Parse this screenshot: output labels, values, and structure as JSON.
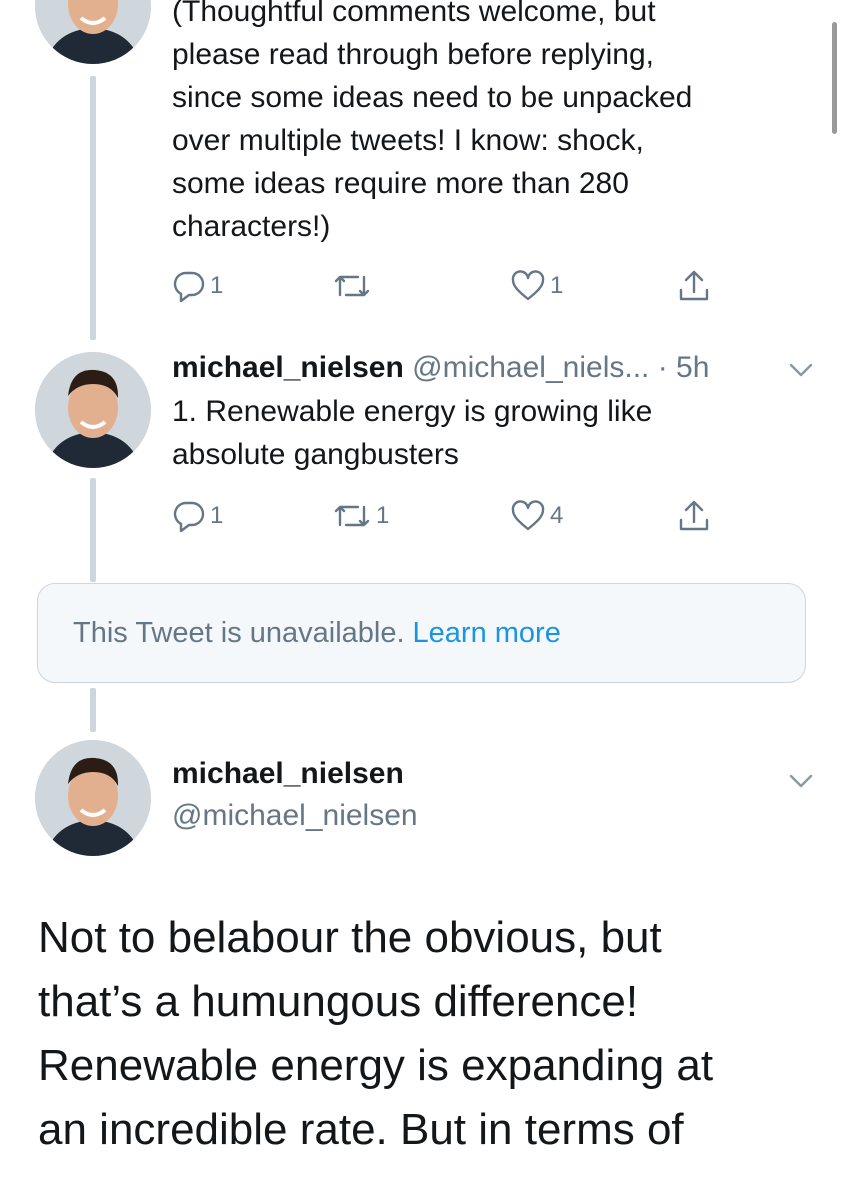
{
  "tweet1": {
    "text_lines": [
      "(Thoughtful comments welcome, but",
      "please read through before replying,",
      "since some ideas need to be unpacked",
      "over multiple tweets! I know: shock,",
      "some ideas require more than 280",
      "characters!)"
    ],
    "reply_count": "1",
    "retweet_count": "",
    "like_count": "1"
  },
  "tweet2": {
    "name": "michael_nielsen",
    "handle": "@michael_niels...",
    "time": "· 5h",
    "text_lines": [
      "1. Renewable energy is growing like",
      "absolute gangbusters"
    ],
    "reply_count": "1",
    "retweet_count": "1",
    "like_count": "4"
  },
  "unavailable": {
    "text": "This Tweet is unavailable.",
    "link": "Learn more"
  },
  "main_tweet": {
    "name": "michael_nielsen",
    "handle": "@michael_nielsen",
    "text_lines": [
      "Not to belabour the obvious, but",
      "that’s a humungous difference!",
      "Renewable energy is expanding at",
      "an incredible rate. But in terms of"
    ]
  },
  "colors": {
    "text": "#14171a",
    "secondary": "#657786",
    "link": "#1b95e0",
    "thread_line": "#ccd6dd",
    "card_bg": "#f5f8fa"
  },
  "icons": [
    "reply-icon",
    "retweet-icon",
    "like-icon",
    "share-icon",
    "chevron-down-icon"
  ]
}
